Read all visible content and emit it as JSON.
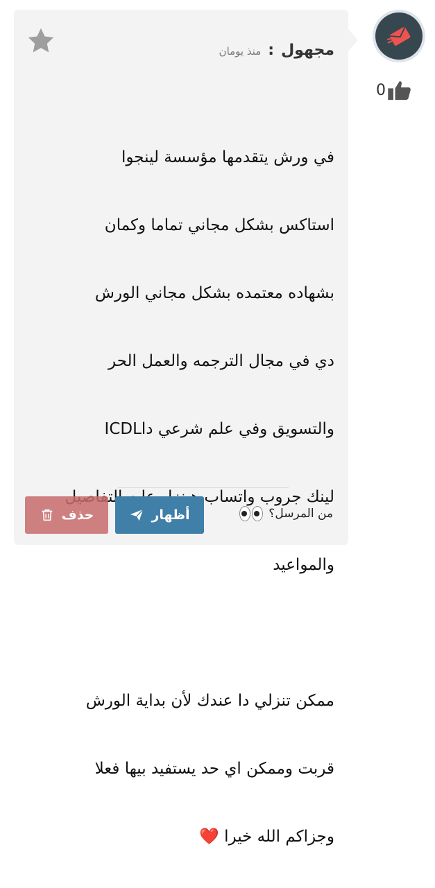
{
  "post": {
    "sender": "مجهول",
    "separator": ":",
    "time": "منذ يومان",
    "message_lines": [
      "في ورش يتقدمها مؤسسة لينجوا",
      "استاكس بشكل مجاني تماما وكمان",
      "بشهاده معتمده بشكل مجاني الورش",
      "دي في مجال الترجمه والعمل الحر",
      "والتسويق وفي علم شرعي داICDL",
      "لينك جروب واتساب هينزل عليه التفاصيل",
      "والمواعيد",
      "",
      "ممكن تنزلي دا عندك لأن بداية الورش",
      "قربت وممكن اي حد يستفيد بيها فعلا",
      "وجزاكم الله خيرا"
    ],
    "heart_emoji": "❤️"
  },
  "actions": {
    "delete_label": "حذف",
    "show_label": "أظهار",
    "who_sent": "من المرسل؟"
  },
  "likes": {
    "count": "0"
  },
  "colors": {
    "card_bg": "#f3f3f3",
    "delete_btn": "#c86b6b",
    "show_btn": "#3f7fa8",
    "avatar_bg": "#37474f",
    "avatar_accent": "#ef5350"
  },
  "icons": {
    "favorite": "star-icon",
    "avatar": "envelope-icon",
    "like": "thumbs-up-icon",
    "delete": "trash-icon",
    "show": "paper-plane-icon",
    "who": "eyes-icon"
  }
}
